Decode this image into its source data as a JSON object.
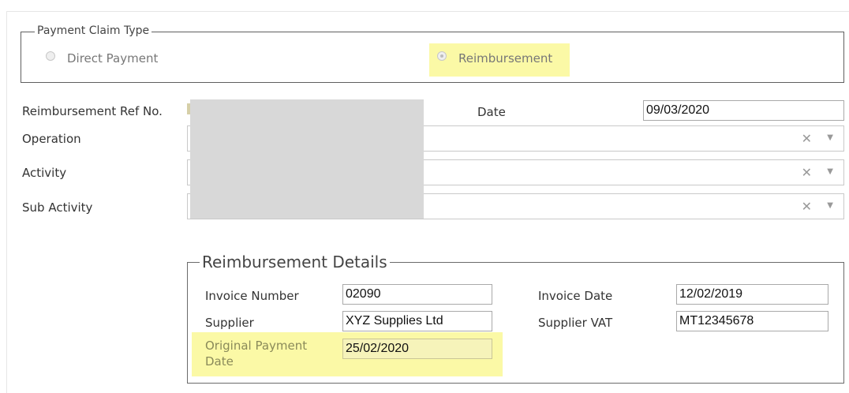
{
  "claim_type": {
    "legend": "Payment Claim Type",
    "options": [
      {
        "label": "Direct Payment",
        "selected": false
      },
      {
        "label": "Reimbursement",
        "selected": true
      }
    ]
  },
  "form": {
    "ref_label": "Reimbursement Ref No.",
    "date_label": "Date",
    "date_value": "09/03/2020",
    "operation_label": "Operation",
    "activity_label": "Activity",
    "sub_activity_label": "Sub Activity",
    "clear_glyph": "✕",
    "dropdown_glyph": "▼"
  },
  "details": {
    "legend": "Reimbursement Details",
    "invoice_number_label": "Invoice Number",
    "invoice_number_value": "02090",
    "invoice_date_label": "Invoice Date",
    "invoice_date_value": "12/02/2019",
    "supplier_label": "Supplier",
    "supplier_value": "XYZ Supplies Ltd",
    "supplier_vat_label": "Supplier VAT",
    "supplier_vat_value": "MT12345678",
    "original_payment_date_label": "Original Payment Date",
    "original_payment_date_value": "25/02/2020"
  },
  "colors": {
    "highlight": "#fbf9a6",
    "redaction": "#d8d8d8"
  }
}
